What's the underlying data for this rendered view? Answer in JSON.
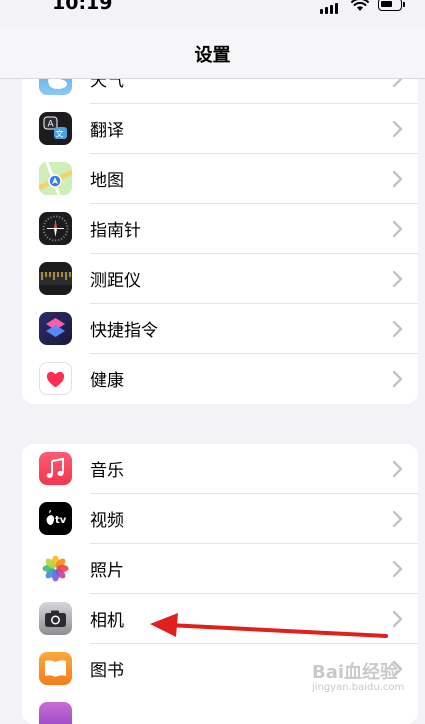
{
  "status": {
    "time": "10:19"
  },
  "nav": {
    "title": "设置"
  },
  "group1": [
    {
      "label": "天气",
      "icon": "weather-icon"
    },
    {
      "label": "翻译",
      "icon": "translate-icon"
    },
    {
      "label": "地图",
      "icon": "maps-icon"
    },
    {
      "label": "指南针",
      "icon": "compass-icon"
    },
    {
      "label": "测距仪",
      "icon": "measure-icon"
    },
    {
      "label": "快捷指令",
      "icon": "shortcuts-icon"
    },
    {
      "label": "健康",
      "icon": "health-icon"
    }
  ],
  "group2": [
    {
      "label": "音乐",
      "icon": "music-icon"
    },
    {
      "label": "视频",
      "icon": "tv-icon"
    },
    {
      "label": "照片",
      "icon": "photos-icon"
    },
    {
      "label": "相机",
      "icon": "camera-icon"
    },
    {
      "label": "图书",
      "icon": "books-icon"
    }
  ],
  "icon_glyphs": {
    "translate": "A",
    "translate_alt": "文",
    "tv": "tv"
  },
  "watermark": {
    "text": "Bai血经验",
    "sub": "jingyan.baidu.com"
  },
  "colors": {
    "background": "#f2f2f7",
    "card": "#ffffff",
    "chevron": "#c4c4c7",
    "annotation_arrow": "#e0201c"
  }
}
